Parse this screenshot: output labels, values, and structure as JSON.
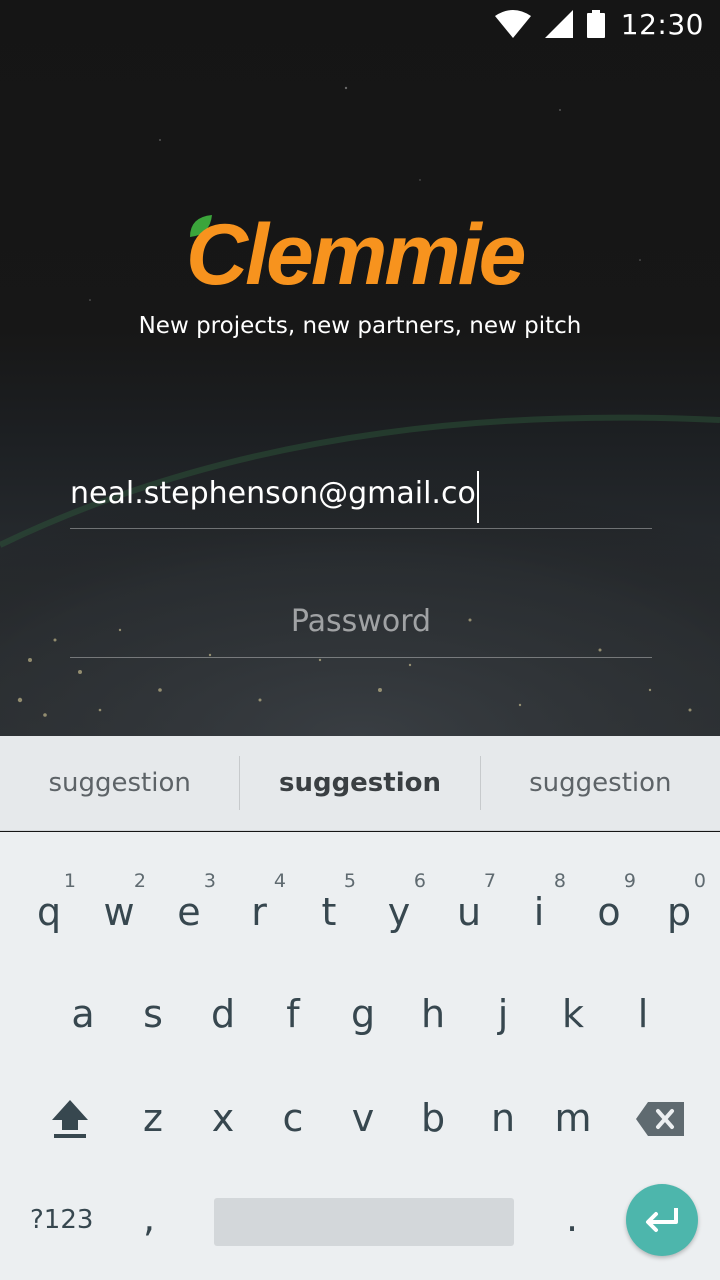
{
  "status_bar": {
    "time": "12:30",
    "icons": [
      "wifi-icon",
      "cell-signal-icon",
      "battery-icon"
    ]
  },
  "brand": {
    "name": "Clemmie",
    "tagline": "New projects, new partners, new pitch",
    "accent_color": "#F7931E",
    "leaf_color": "#3BA53B"
  },
  "login_form": {
    "email_value": "neal.stephenson@gmail.co",
    "password_placeholder": "Password"
  },
  "keyboard": {
    "suggestions": [
      "suggestion",
      "suggestion",
      "suggestion"
    ],
    "row1": [
      {
        "ch": "q",
        "hint": "1"
      },
      {
        "ch": "w",
        "hint": "2"
      },
      {
        "ch": "e",
        "hint": "3"
      },
      {
        "ch": "r",
        "hint": "4"
      },
      {
        "ch": "t",
        "hint": "5"
      },
      {
        "ch": "y",
        "hint": "6"
      },
      {
        "ch": "u",
        "hint": "7"
      },
      {
        "ch": "i",
        "hint": "8"
      },
      {
        "ch": "o",
        "hint": "9"
      },
      {
        "ch": "p",
        "hint": "0"
      }
    ],
    "row2": [
      "a",
      "s",
      "d",
      "f",
      "g",
      "h",
      "j",
      "k",
      "l"
    ],
    "row3": [
      "z",
      "x",
      "c",
      "v",
      "b",
      "n",
      "m"
    ],
    "symbols_label": "?123",
    "comma": ",",
    "period": ".",
    "enter_color": "#4DB6AC"
  }
}
